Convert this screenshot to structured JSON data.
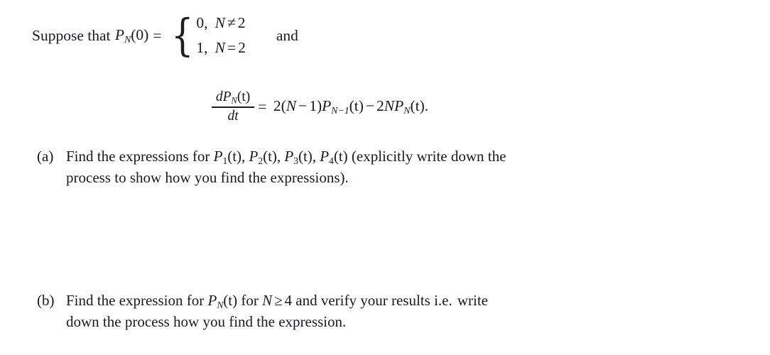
{
  "document": {
    "type": "math-problem-statement",
    "background_color": "#ffffff",
    "text_color": "#1a1a1f",
    "preamble": {
      "lead_text": "Suppose that",
      "function_name": "P",
      "function_subscript": "N",
      "function_argument": "(0)",
      "equals": "=",
      "cases": [
        {
          "value": "0,",
          "variable": "N",
          "relation": "≠",
          "rhs": "2"
        },
        {
          "value": "1,",
          "variable": "N",
          "relation": "=",
          "rhs": "2"
        }
      ],
      "conjunction": "and"
    },
    "equation": {
      "numerator": {
        "d": "d",
        "function": "P",
        "subscript": "N",
        "argument": "(t)"
      },
      "denominator": "dt",
      "equals": "=",
      "rhs": {
        "coefficient_1": "2",
        "open_paren": "(",
        "variable": "N",
        "minus": "−",
        "one": "1",
        "close_paren": ")",
        "term_1_function": "P",
        "term_1_subscript": "N−1",
        "term_1_argument": "(t)",
        "operator": "−",
        "coefficient_2": "2",
        "coefficient_2_var": "N",
        "term_2_function": "P",
        "term_2_subscript": "N",
        "term_2_argument": "(t)",
        "period": "."
      }
    },
    "items": [
      {
        "tag": "(a)",
        "line1_pre": "Find the expressions for ",
        "functions": [
          {
            "name": "P",
            "sub": "1",
            "arg": "(t)",
            "sep": ", "
          },
          {
            "name": "P",
            "sub": "2",
            "arg": "(t)",
            "sep": ", "
          },
          {
            "name": "P",
            "sub": "3",
            "arg": "(t)",
            "sep": ", "
          },
          {
            "name": "P",
            "sub": "4",
            "arg": "(t)",
            "sep": " "
          }
        ],
        "line1_post": "(explicitly write down the",
        "line2": "process to show how you find the expressions)."
      },
      {
        "tag": "(b)",
        "line1_pre": "Find the expression for ",
        "function": {
          "name": "P",
          "sub": "N",
          "arg": "(t)"
        },
        "line1_mid": " for ",
        "variable": "N",
        "relation": "≥",
        "bound": "4",
        "line1_post_a": " and verify your results i.e.",
        "line1_post_b": "write",
        "line2": "down the process how you find the expression."
      }
    ]
  }
}
